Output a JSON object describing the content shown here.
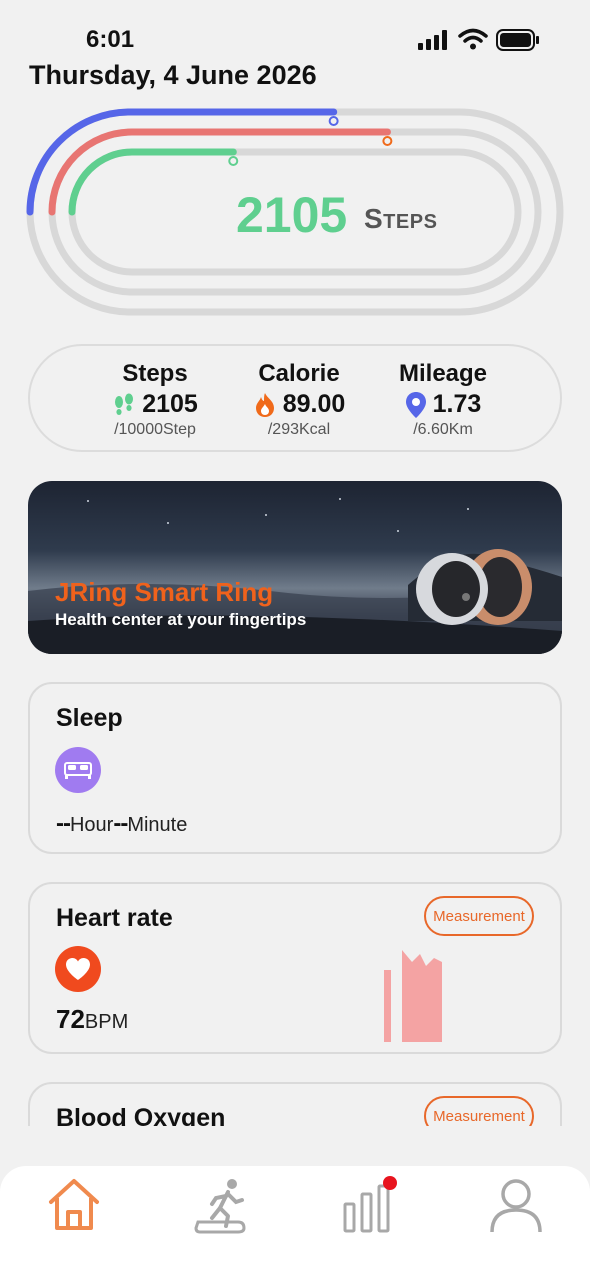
{
  "status": {
    "time": "6:01"
  },
  "date_title": "Thursday, 4 June 2026",
  "track": {
    "count": "2105",
    "unit": "Steps",
    "progress": {
      "mileage": 0.56,
      "calorie": 0.66,
      "steps": 0.38
    },
    "colors": {
      "mileage": "#5666e8",
      "calorie": "#e87572",
      "steps": "#5fcf8f",
      "lane": "#d8d8d8"
    }
  },
  "summary": {
    "steps": {
      "label": "Steps",
      "value": "2105",
      "goal": "/10000Step",
      "icon": "footprints-icon"
    },
    "calorie": {
      "label": "Calorie",
      "value": "89.00",
      "goal": "/293Kcal",
      "icon": "flame-icon"
    },
    "mileage": {
      "label": "Mileage",
      "value": "1.73",
      "goal": "/6.60Km",
      "icon": "location-pin-icon"
    }
  },
  "banner": {
    "title": "JRing Smart Ring",
    "subtitle": "Health center at your fingertips"
  },
  "sleep": {
    "title": "Sleep",
    "hours": "--",
    "hour_unit": "Hour",
    "minutes": "--",
    "minute_unit": "Minute",
    "icon": "bed-icon",
    "icon_color": "#a07bf0"
  },
  "heart_rate": {
    "title": "Heart rate",
    "measure_label": "Measurement",
    "value": "72",
    "unit": "BPM",
    "icon": "heart-icon",
    "icon_color": "#f04a1e",
    "chart_color": "#f4a3a3"
  },
  "blood_oxygen": {
    "title": "Blood Oxygen",
    "measure_label": "Measurement"
  },
  "nav": {
    "items": [
      "home-icon",
      "exercise-icon",
      "stats-icon",
      "profile-icon"
    ],
    "active_color": "#f08a4e",
    "inactive_color": "#a8a8a8",
    "badge_color": "#e8141e"
  }
}
